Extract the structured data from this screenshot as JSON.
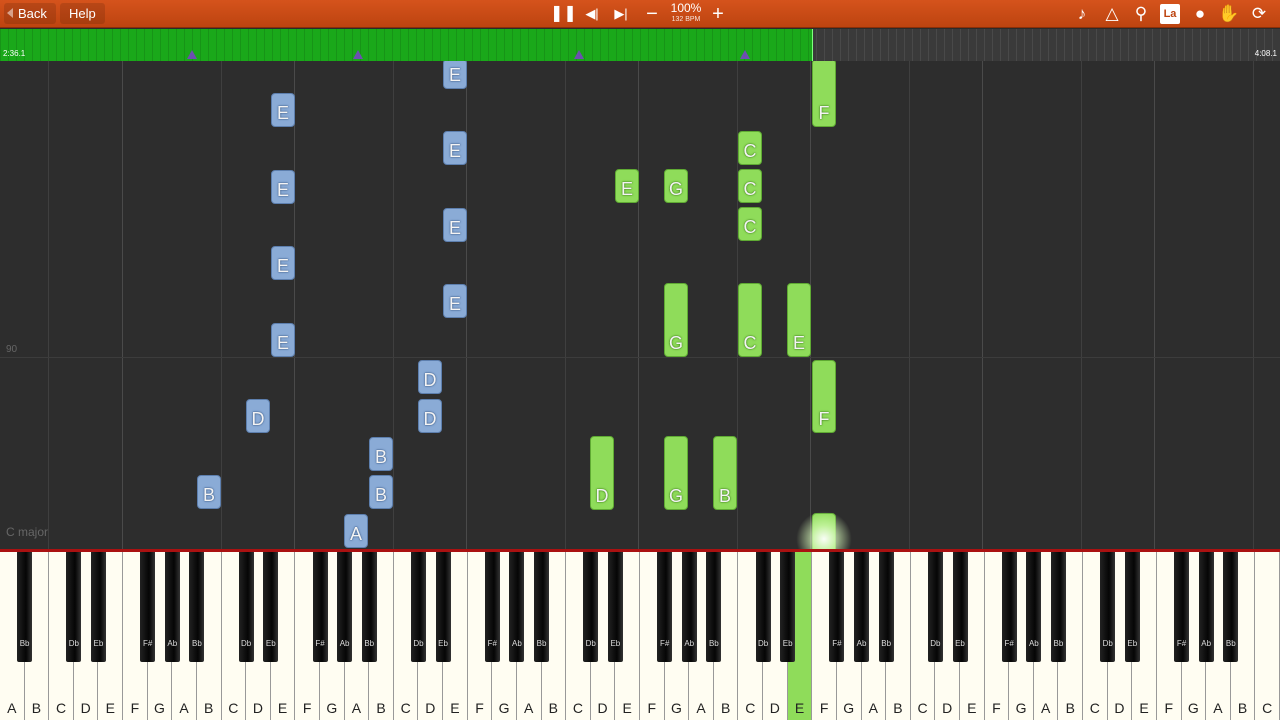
{
  "toolbar": {
    "back_label": "Back",
    "help_label": "Help",
    "speed_percent": "100%",
    "bpm": "132 BPM",
    "icons": [
      "pause-icon",
      "rewind-icon",
      "skip-forward-icon",
      "minus-icon",
      "plus-icon",
      "note-icon",
      "metronome-icon",
      "magnifier-icon",
      "label-icon",
      "location-pin-icon",
      "hand-icon",
      "loop-icon"
    ],
    "label_icon_text": "La"
  },
  "progress": {
    "start_time": "2:36.1",
    "end_time": "4:08.1",
    "played_fraction": 0.635
  },
  "roll": {
    "measure_number": "90",
    "key_signature": "C major"
  },
  "notes_blue": [
    "E",
    "E",
    "E",
    "E",
    "E",
    "E",
    "E",
    "E",
    "E",
    "D",
    "D",
    "D",
    "B",
    "B",
    "B",
    "A"
  ],
  "notes_green": [
    "F",
    "C",
    "E",
    "G",
    "C",
    "C",
    "G",
    "C",
    "E",
    "F",
    "D",
    "G",
    "B",
    ""
  ],
  "keyboard": {
    "white_keys": [
      "A",
      "B",
      "C",
      "D",
      "E",
      "F",
      "G",
      "A",
      "B",
      "C",
      "D",
      "E",
      "F",
      "G",
      "A",
      "B",
      "C",
      "D",
      "E",
      "F",
      "G",
      "A",
      "B",
      "C",
      "D",
      "E",
      "F",
      "G",
      "A",
      "B",
      "C",
      "D",
      "E",
      "F",
      "G",
      "A",
      "B",
      "C",
      "D",
      "E",
      "F",
      "G",
      "A",
      "B",
      "C",
      "D",
      "E",
      "F",
      "G",
      "A",
      "B",
      "C"
    ],
    "black_keys": [
      "Bb",
      "Db",
      "Eb",
      "F#",
      "Ab",
      "Bb",
      "Db",
      "Eb",
      "F#",
      "Ab",
      "Bb",
      "Db",
      "Eb",
      "F#",
      "Ab",
      "Bb",
      "Db",
      "Eb",
      "F#",
      "Ab",
      "Bb",
      "Db",
      "Eb",
      "F#",
      "Ab",
      "Bb",
      "Db",
      "Eb",
      "F#",
      "Ab",
      "Bb",
      "Db",
      "Eb",
      "F#",
      "Ab",
      "Bb"
    ],
    "active_key": "F"
  }
}
